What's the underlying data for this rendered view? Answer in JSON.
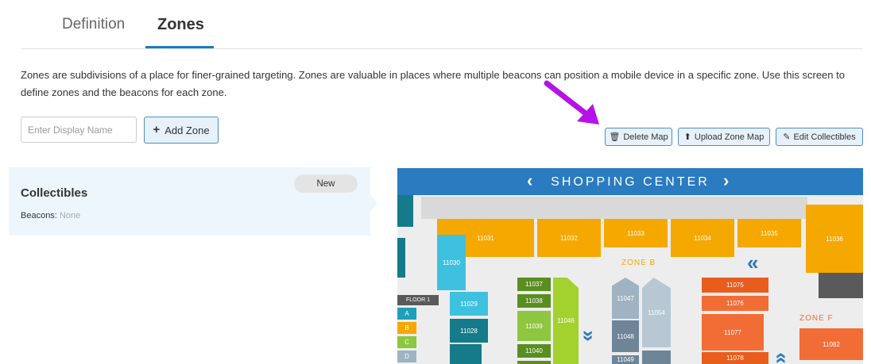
{
  "tabs": {
    "definition": "Definition",
    "zones": "Zones"
  },
  "description": "Zones are subdivisions of a place for finer-grained targeting. Zones are valuable in places where multiple beacons can position a mobile device in a specific zone. Use this screen to define zones and the beacons for each zone.",
  "form": {
    "name_placeholder": "Enter Display Name",
    "add_zone_label": "Add Zone"
  },
  "toolbar": {
    "delete_map": "Delete Map",
    "upload_zone_map": "Upload Zone Map",
    "edit_collectibles": "Edit Collectibles"
  },
  "zone_card": {
    "title": "Collectibles",
    "badge": "New",
    "beacons_label": "Beacons:",
    "beacons_value": "None"
  },
  "map": {
    "title": "SHOPPING CENTER",
    "zone_b": "ZONE B",
    "zone_f": "ZONE F",
    "floor": "FLOOR 1",
    "floor_keys": [
      "A",
      "B",
      "C",
      "D"
    ],
    "stores": {
      "s11031": "11031",
      "s11032": "11032",
      "s11033": "11033",
      "s11034": "11034",
      "s11035": "11035",
      "s11036": "11036",
      "s11030": "11030",
      "s11029": "11029",
      "s11028": "11028",
      "s11037": "11037",
      "s11038": "11038",
      "s11039": "11039",
      "s11040": "11040",
      "s11046": "11046",
      "s11047": "11047",
      "s11048": "11048",
      "s11049": "11049",
      "s11054": "11054",
      "s11075": "11075",
      "s11076": "11076",
      "s11077": "11077",
      "s11078": "11078",
      "s11082": "11082"
    }
  },
  "colors": {
    "accent": "#1a7bbf",
    "map_header": "#2a7bc0",
    "annotation_arrow": "#b512e8",
    "orange": "#f5a800",
    "teal": "#1f9fb8",
    "green": "#8dc63f",
    "grey": "#9fb3c2",
    "coral": "#f26d36"
  }
}
